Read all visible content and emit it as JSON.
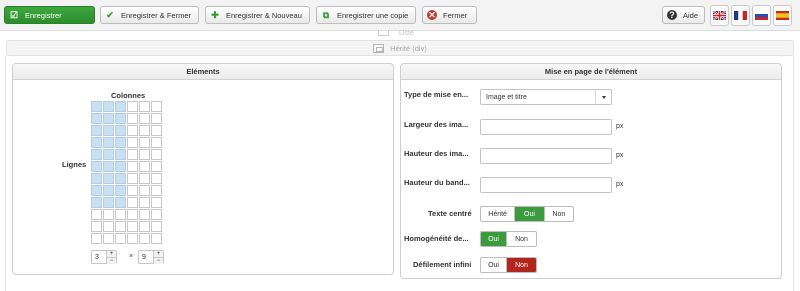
{
  "toolbar": {
    "save": "Enregistrer",
    "save_close": "Enregistrer & Fermer",
    "save_new": "Enregistrer & Nouveau",
    "save_copy": "Enregistrer une copie",
    "close": "Fermer",
    "help": "Aide",
    "languages": [
      "en-GB",
      "fr-FR",
      "ru-RU",
      "es-ES"
    ]
  },
  "faded_header": "Liste",
  "inherited_bar": "Hérité (div)",
  "elements_panel": {
    "title": "Eléments",
    "columns_label": "Colonnes",
    "rows_label": "Lignes",
    "grid": {
      "cols": 6,
      "rows": 12,
      "selected_cols": 3,
      "selected_rows": 9
    },
    "cols_value": "3",
    "rows_value": "9",
    "times": "×"
  },
  "layout_panel": {
    "title": "Mise en page de l'élément",
    "fields": {
      "display_type": {
        "label": "Type de mise en...",
        "value": "Image et titre"
      },
      "image_width": {
        "label": "Largeur des ima...",
        "value": "",
        "unit": "px"
      },
      "image_height": {
        "label": "Hauteur des ima...",
        "value": "",
        "unit": "px"
      },
      "band_height": {
        "label": "Hauteur du band...",
        "value": "",
        "unit": "px"
      },
      "centered_text": {
        "label": "Texte centré",
        "options": [
          "Hérité",
          "Oui",
          "Non"
        ],
        "selected": "Oui"
      },
      "homogeneity": {
        "label": "Homogénéité de...",
        "options": [
          "Oui",
          "Non"
        ],
        "selected": "Oui"
      },
      "infinite_scroll": {
        "label": "Défilement infini",
        "options": [
          "Oui",
          "Non"
        ],
        "selected": "Non"
      }
    }
  },
  "colors": {
    "green": "#3c9b3c",
    "red": "#b3261e",
    "grid_selected": "#c9dff2"
  }
}
